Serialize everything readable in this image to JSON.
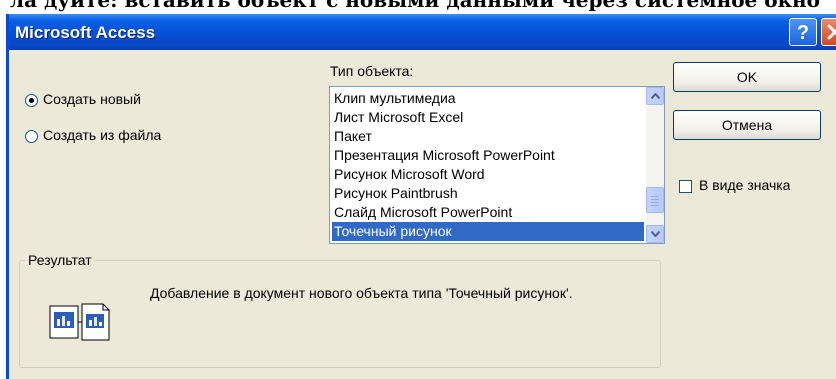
{
  "background_caption": "ла дуйте: вставить объект с новыми данными через системное окно",
  "dialog": {
    "title": "Microsoft Access",
    "help_label": "?",
    "radios": {
      "create_new": "Создать новый",
      "create_from_file": "Создать из файла",
      "selected": "create_new"
    },
    "object_type_label": "Тип объекта:",
    "object_types": [
      "Клип мультимедиа",
      "Лист Microsoft Excel",
      "Пакет",
      "Презентация Microsoft PowerPoint",
      "Рисунок Microsoft Word",
      "Рисунок Paintbrush",
      "Слайд Microsoft PowerPoint",
      "Точечный рисунок"
    ],
    "selected_object_type": "Точечный рисунок",
    "ok_label": "OK",
    "cancel_label": "Отмена",
    "display_as_icon_label": "В виде значка",
    "display_as_icon_checked": false,
    "result_group_label": "Результат",
    "result_text": "Добавление в документ нового объекта типа 'Точечный рисунок'."
  },
  "colors": {
    "title_bar": "#0450d6",
    "selection": "#316ac5",
    "dialog_face": "#ece9d8"
  }
}
